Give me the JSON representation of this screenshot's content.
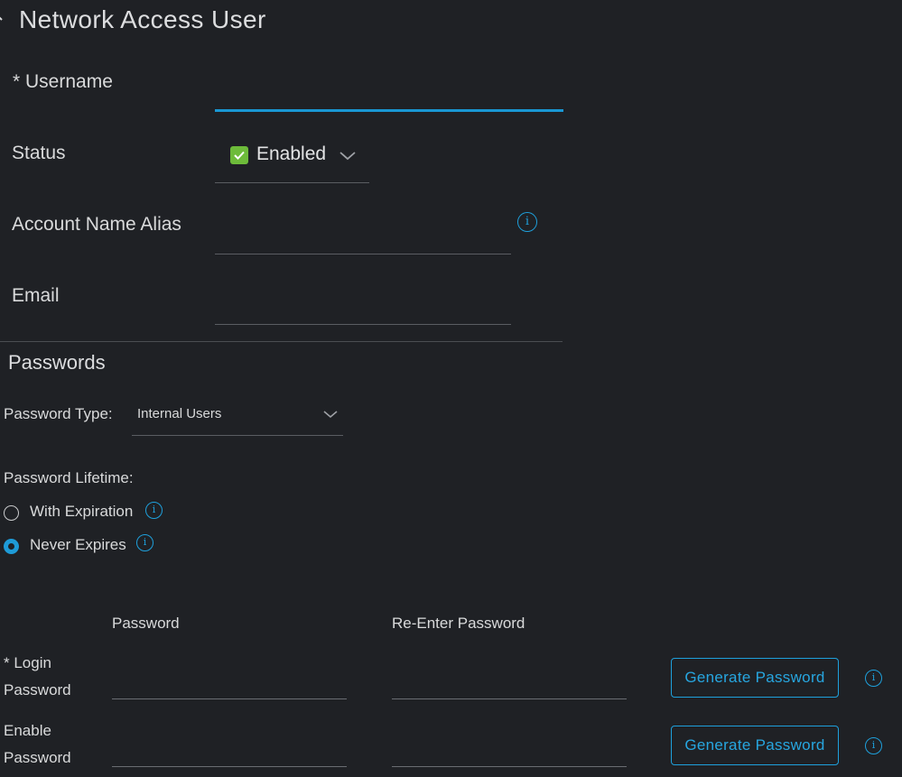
{
  "header": {
    "title": "Network Access User"
  },
  "form": {
    "username": {
      "label": "* Username",
      "value": ""
    },
    "status": {
      "label": "Status",
      "value": "Enabled"
    },
    "alias": {
      "label": "Account Name Alias",
      "value": ""
    },
    "email": {
      "label": "Email",
      "value": ""
    }
  },
  "passwords": {
    "title": "Passwords",
    "type_label": "Password Type:",
    "type_value": "Internal Users",
    "lifetime_label": "Password Lifetime:",
    "lifetime_options": [
      {
        "label": "With Expiration",
        "checked": false
      },
      {
        "label": "Never Expires",
        "checked": true
      }
    ],
    "col_password": "Password",
    "col_reenter": "Re-Enter Password",
    "rows": [
      {
        "label_line1": "* Login",
        "label_line2": "Password",
        "button": "Generate Password"
      },
      {
        "label_line1": "Enable",
        "label_line2": "Password",
        "button": "Generate Password"
      }
    ]
  },
  "icons": {
    "info": "info-icon",
    "check": "check-icon",
    "chevron": "chevron-down-icon",
    "collapse": "chevron-collapse-icon"
  },
  "colors": {
    "background": "#1f2125",
    "accent": "#1ea0dc",
    "check_green": "#6dbb3a",
    "text": "#d9dadb"
  }
}
